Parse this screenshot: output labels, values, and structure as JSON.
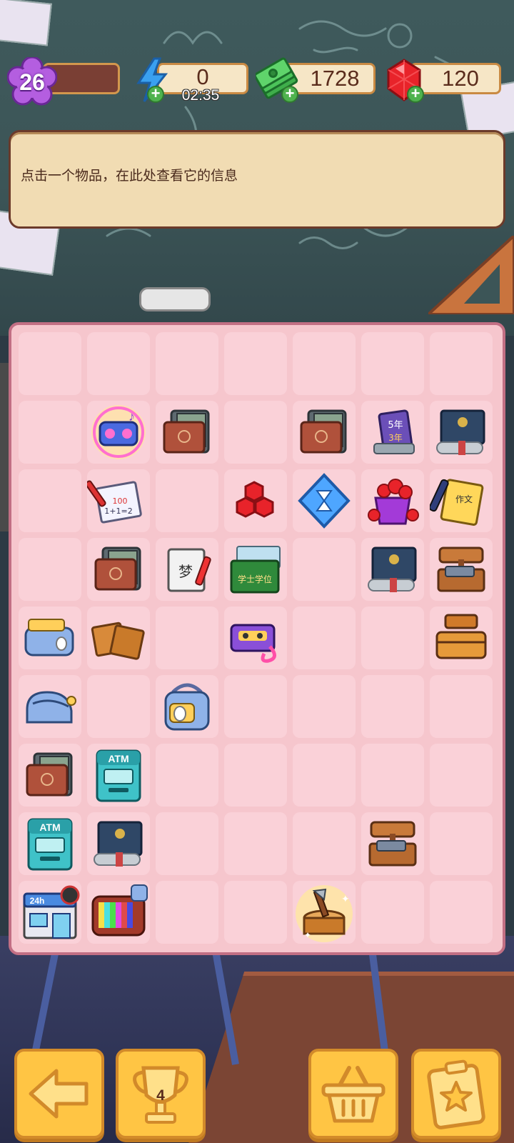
{
  "hud": {
    "level": "26",
    "energy": {
      "value": "0",
      "timer": "02:35",
      "icon": "lightning-icon"
    },
    "cash": {
      "value": "1728",
      "icon": "cash-stack-icon"
    },
    "gems": {
      "value": "120",
      "icon": "ruby-gem-icon"
    }
  },
  "info_panel": {
    "text": "点击一个物品，在此处查看它的信息"
  },
  "side_tab": {
    "glyph": "›"
  },
  "board": {
    "items": [
      {
        "name": "music-device",
        "kind": "radio"
      },
      {
        "name": "wallet-stack",
        "kind": "wallet"
      },
      {
        "name": "wallet-stack",
        "kind": "wallet"
      },
      {
        "name": "graduation-books",
        "kind": "books",
        "label": "5年 3年"
      },
      {
        "name": "diploma-book",
        "kind": "diploma"
      },
      {
        "name": "test-paper",
        "kind": "testpaper",
        "label": "100 1+1=2"
      },
      {
        "name": "red-gems",
        "kind": "redgems"
      },
      {
        "name": "hourglass-crystal",
        "kind": "hourglass"
      },
      {
        "name": "gem-bucket",
        "kind": "gembucket"
      },
      {
        "name": "essay-papers",
        "kind": "essay",
        "label": "作文"
      },
      {
        "name": "wallet-stack",
        "kind": "wallet"
      },
      {
        "name": "dream-notebook",
        "kind": "dream",
        "label": "梦"
      },
      {
        "name": "bachelor-degree",
        "kind": "bachelor",
        "label": "学士学位"
      },
      {
        "name": "diploma-book",
        "kind": "diploma"
      },
      {
        "name": "signboard-cash",
        "kind": "signcash"
      },
      {
        "name": "bunny-pencil-case",
        "kind": "pencilcase"
      },
      {
        "name": "wooden-planks",
        "kind": "planks"
      },
      {
        "name": "cassette-tape",
        "kind": "cassette"
      },
      {
        "name": "wooden-chest",
        "kind": "woodchest"
      },
      {
        "name": "blue-pouch",
        "kind": "pouch"
      },
      {
        "name": "bunny-backpack",
        "kind": "backpack"
      },
      {
        "name": "wallet-stack",
        "kind": "wallet"
      },
      {
        "name": "atm-machine",
        "kind": "atm",
        "label": "ATM"
      },
      {
        "name": "atm-machine",
        "kind": "atm",
        "label": "ATM"
      },
      {
        "name": "diploma-book",
        "kind": "diploma"
      },
      {
        "name": "signboard-cash",
        "kind": "signcash"
      },
      {
        "name": "convenience-store",
        "kind": "store",
        "label": "24h"
      },
      {
        "name": "retro-tv",
        "kind": "tv"
      },
      {
        "name": "tree-stump-axe",
        "kind": "stump"
      }
    ]
  },
  "buttons": {
    "back": {
      "icon": "arrow-left-icon"
    },
    "trophy": {
      "icon": "trophy-icon",
      "count": "4"
    },
    "basket": {
      "icon": "basket-icon"
    },
    "tasks": {
      "icon": "clipboard-star-icon"
    }
  },
  "colors": {
    "board_bg": "#f6c6cd",
    "cell_bg": "#fad1d8",
    "button_bg": "#ffc544",
    "panel_bg": "#f1dcb3"
  }
}
